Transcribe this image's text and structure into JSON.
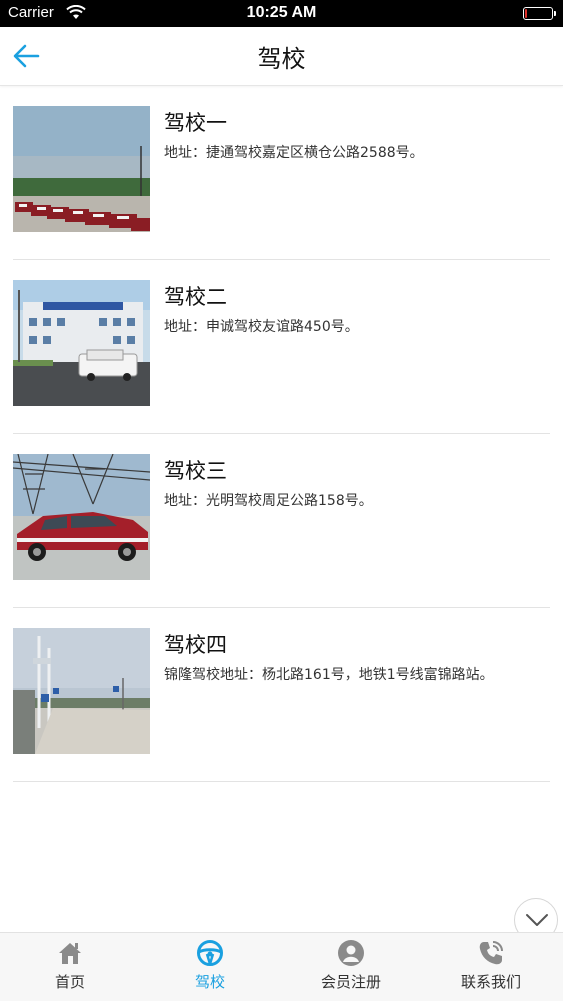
{
  "status_bar": {
    "carrier": "Carrier",
    "time": "10:25 AM",
    "battery_level": 0.08
  },
  "header": {
    "title": "驾校"
  },
  "schools": [
    {
      "name": "驾校一",
      "address": "地址：捷通驾校嘉定区横仓公路2588号。"
    },
    {
      "name": "驾校二",
      "address": "地址：申诚驾校友谊路450号。"
    },
    {
      "name": "驾校三",
      "address": "地址：光明驾校周足公路158号。"
    },
    {
      "name": "驾校四",
      "address": "锦隆驾校地址：杨北路161号，地铁1号线富锦路站。"
    }
  ],
  "tabbar": {
    "tabs": [
      {
        "label": "首页",
        "icon": "home-icon",
        "active": false
      },
      {
        "label": "驾校",
        "icon": "steering-wheel-icon",
        "active": true
      },
      {
        "label": "会员注册",
        "icon": "user-icon",
        "active": false
      },
      {
        "label": "联系我们",
        "icon": "phone-icon",
        "active": false
      }
    ]
  },
  "colors": {
    "accent": "#1aa0e0",
    "inactive_icon": "#8a8a8a",
    "battery": "#e0302a"
  }
}
